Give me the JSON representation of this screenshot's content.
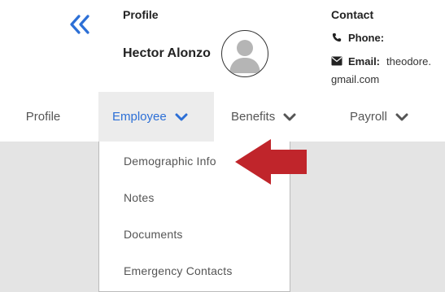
{
  "header": {
    "profile_label": "Profile",
    "user_name": "Hector Alonzo",
    "contact_label": "Contact",
    "phone_label": "Phone:",
    "phone_value": "",
    "email_label": "Email:",
    "email_value_line1": "theodore.",
    "email_value_line2": "gmail.com"
  },
  "tabs": [
    {
      "label": "Profile",
      "active": false
    },
    {
      "label": "Employee",
      "active": true
    },
    {
      "label": "Benefits",
      "active": false
    },
    {
      "label": "Payroll",
      "active": false
    }
  ],
  "employee_menu": {
    "items": [
      {
        "label": "Demographic Info"
      },
      {
        "label": "Notes"
      },
      {
        "label": "Documents"
      },
      {
        "label": "Emergency Contacts"
      }
    ]
  },
  "colors": {
    "accent_blue": "#2c6fd6",
    "arrow_red": "#c0252b",
    "active_tab_bg": "#ececec",
    "content_bg": "#e4e4e4"
  },
  "icons": {
    "collapse": "double-chevron-left-icon",
    "phone": "phone-icon",
    "email": "envelope-icon",
    "avatar": "user-silhouette-icon",
    "tab_chevron": "chevron-down-icon",
    "pointer": "red-arrow-left-icon"
  }
}
